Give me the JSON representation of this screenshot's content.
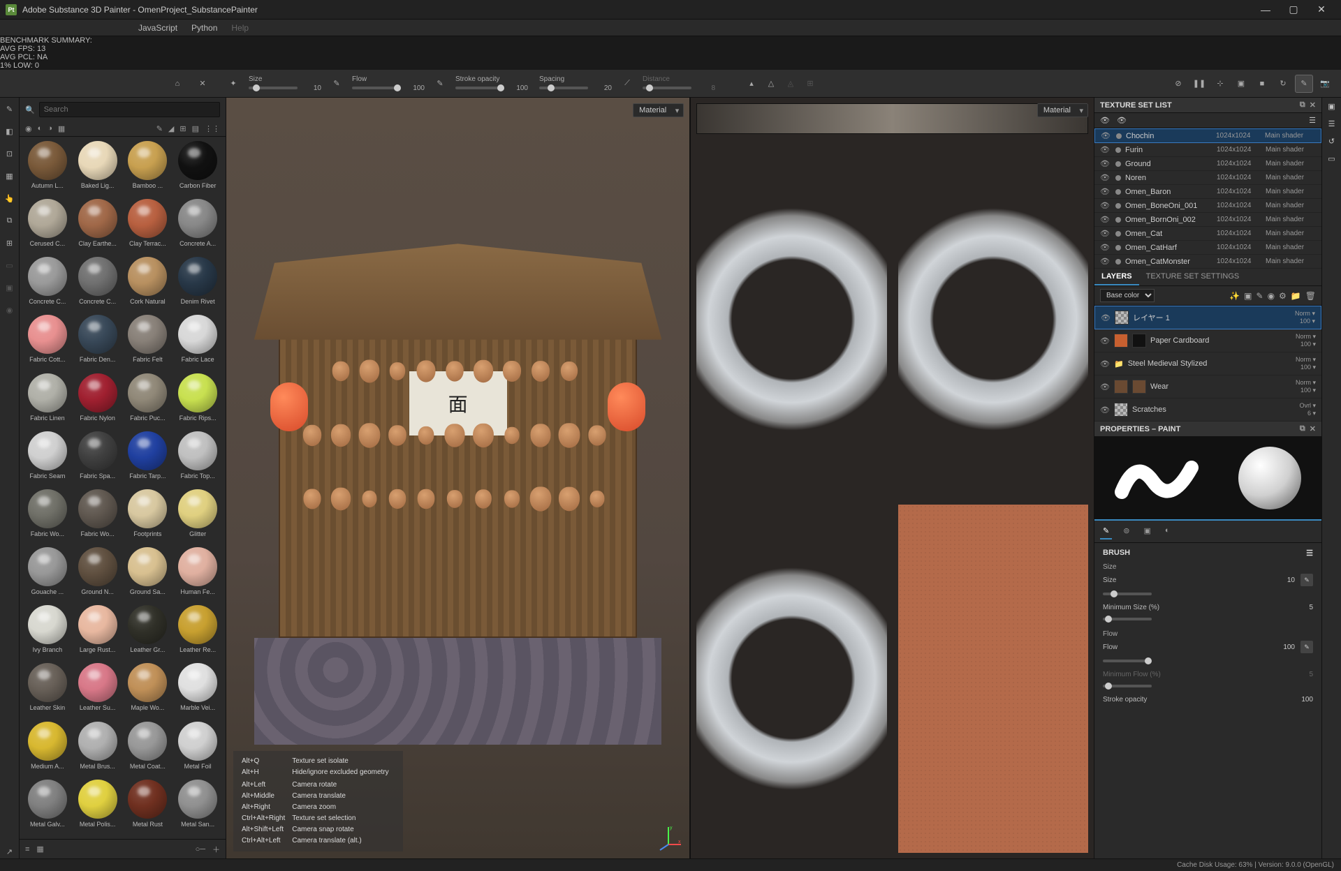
{
  "app": {
    "title": "Adobe Substance 3D Painter - OmenProject_SubstancePainter",
    "icon_label": "Pt"
  },
  "overlay": {
    "l1": "BENCHMARK SUMMARY:",
    "l2": "AVG FPS:    13",
    "l3": "AVG PCL:    NA",
    "l4": "1%  LOW:     0"
  },
  "menu": {
    "javascript": "JavaScript",
    "python": "Python",
    "help": "Help"
  },
  "toolbar": {
    "size_label": "Size",
    "size_val": "10",
    "flow_label": "Flow",
    "flow_val": "100",
    "opacity_label": "Stroke opacity",
    "opacity_val": "100",
    "spacing_label": "Spacing",
    "spacing_val": "20",
    "distance_label": "Distance",
    "distance_val": "8"
  },
  "shelf": {
    "search_placeholder": "Search",
    "materials": [
      {
        "n": "Autumn L...",
        "c": "#7a5a3a"
      },
      {
        "n": "Baked Lig...",
        "c": "#e8d8b8"
      },
      {
        "n": "Bamboo ...",
        "c": "#c8a050"
      },
      {
        "n": "Carbon Fiber",
        "c": "#111111"
      },
      {
        "n": "Cerused C...",
        "c": "#b0a898"
      },
      {
        "n": "Clay Earthe...",
        "c": "#a06848"
      },
      {
        "n": "Clay Terrac...",
        "c": "#b86040"
      },
      {
        "n": "Concrete A...",
        "c": "#888888"
      },
      {
        "n": "Concrete C...",
        "c": "#9a9a9a"
      },
      {
        "n": "Concrete C...",
        "c": "#707070"
      },
      {
        "n": "Cork Natural",
        "c": "#b89060"
      },
      {
        "n": "Denim Rivet",
        "c": "#283848"
      },
      {
        "n": "Fabric Cott...",
        "c": "#e89090"
      },
      {
        "n": "Fabric Den...",
        "c": "#384858"
      },
      {
        "n": "Fabric Felt",
        "c": "#888078"
      },
      {
        "n": "Fabric Lace",
        "c": "#d8d8d8"
      },
      {
        "n": "Fabric Linen",
        "c": "#b0b0a8"
      },
      {
        "n": "Fabric Nylon",
        "c": "#a02030"
      },
      {
        "n": "Fabric Puc...",
        "c": "#908878"
      },
      {
        "n": "Fabric Rips...",
        "c": "#c8e050"
      },
      {
        "n": "Fabric Seam",
        "c": "#d0d0d0"
      },
      {
        "n": "Fabric Spa...",
        "c": "#404040"
      },
      {
        "n": "Fabric Tarp...",
        "c": "#2040a0"
      },
      {
        "n": "Fabric Top...",
        "c": "#c0c0c0"
      },
      {
        "n": "Fabric Wo...",
        "c": "#707068"
      },
      {
        "n": "Fabric Wo...",
        "c": "#605850"
      },
      {
        "n": "Footprints",
        "c": "#d8c8a0"
      },
      {
        "n": "Glitter",
        "c": "#e0d080"
      },
      {
        "n": "Gouache ...",
        "c": "#989898"
      },
      {
        "n": "Ground N...",
        "c": "#605040"
      },
      {
        "n": "Ground Sa...",
        "c": "#d8c090"
      },
      {
        "n": "Human Fe...",
        "c": "#e0b0a0"
      },
      {
        "n": "Ivy Branch",
        "c": "#d8d8d0"
      },
      {
        "n": "Large Rust...",
        "c": "#e8b8a0"
      },
      {
        "n": "Leather Gr...",
        "c": "#303028"
      },
      {
        "n": "Leather Re...",
        "c": "#c8a030"
      },
      {
        "n": "Leather Skin",
        "c": "#686058"
      },
      {
        "n": "Leather Su...",
        "c": "#d87888"
      },
      {
        "n": "Maple Wo...",
        "c": "#c09058"
      },
      {
        "n": "Marble Vei...",
        "c": "#e0e0e0"
      },
      {
        "n": "Medium A...",
        "c": "#d8b830"
      },
      {
        "n": "Metal Brus...",
        "c": "#b0b0b0"
      },
      {
        "n": "Metal Coat...",
        "c": "#989898"
      },
      {
        "n": "Metal Foil",
        "c": "#d0d0d0"
      },
      {
        "n": "Metal Galv...",
        "c": "#808080"
      },
      {
        "n": "Metal Polis...",
        "c": "#e0d040"
      },
      {
        "n": "Metal Rust",
        "c": "#703020"
      },
      {
        "n": "Metal San...",
        "c": "#909090"
      }
    ]
  },
  "viewport": {
    "material_label": "Material",
    "banner_char": "面",
    "hotkeys": [
      [
        "Alt+Q",
        "Texture set isolate"
      ],
      [
        "Alt+H",
        "Hide/ignore excluded geometry"
      ],
      [
        "",
        ""
      ],
      [
        "Alt+Left",
        "Camera rotate"
      ],
      [
        "Alt+Middle",
        "Camera translate"
      ],
      [
        "Alt+Right",
        "Camera zoom"
      ],
      [
        "Ctrl+Alt+Right",
        "Texture set selection"
      ],
      [
        "Alt+Shift+Left",
        "Camera snap rotate"
      ],
      [
        "Ctrl+Alt+Left",
        "Camera translate (alt.)"
      ]
    ]
  },
  "texset": {
    "title": "TEXTURE SET LIST",
    "rows": [
      {
        "n": "Chochin",
        "r": "1024x1024",
        "s": "Main shader",
        "sel": true
      },
      {
        "n": "Furin",
        "r": "1024x1024",
        "s": "Main shader"
      },
      {
        "n": "Ground",
        "r": "1024x1024",
        "s": "Main shader"
      },
      {
        "n": "Noren",
        "r": "1024x1024",
        "s": "Main shader"
      },
      {
        "n": "Omen_Baron",
        "r": "1024x1024",
        "s": "Main shader"
      },
      {
        "n": "Omen_BoneOni_001",
        "r": "1024x1024",
        "s": "Main shader"
      },
      {
        "n": "Omen_BornOni_002",
        "r": "1024x1024",
        "s": "Main shader"
      },
      {
        "n": "Omen_Cat",
        "r": "1024x1024",
        "s": "Main shader"
      },
      {
        "n": "Omen_CatHarf",
        "r": "1024x1024",
        "s": "Main shader"
      },
      {
        "n": "Omen_CatMonster",
        "r": "1024x1024",
        "s": "Main shader"
      }
    ]
  },
  "layers": {
    "tab_layers": "LAYERS",
    "tab_settings": "TEXTURE SET SETTINGS",
    "channel": "Base color",
    "rows": [
      {
        "n": "レイヤー 1",
        "b": "Norm",
        "o": "100",
        "sel": true,
        "t": "checker"
      },
      {
        "n": "Paper Cardboard",
        "b": "Norm",
        "o": "100",
        "t": "orange",
        "m": "black"
      },
      {
        "n": "Steel Medieval Stylized",
        "b": "Norm",
        "o": "100",
        "t": "steel",
        "folder": true
      },
      {
        "n": "Wear",
        "b": "Norm",
        "o": "100",
        "t": "brown",
        "m": "brown"
      },
      {
        "n": "Scratches",
        "b": "Ovrl",
        "o": "6",
        "t": "checker"
      }
    ]
  },
  "props": {
    "title": "PROPERTIES – PAINT",
    "brush_title": "BRUSH",
    "size_section": "Size",
    "size_label": "Size",
    "size_val": "10",
    "minsize_label": "Minimum Size (%)",
    "minsize_val": "5",
    "flow_section": "Flow",
    "flow_label": "Flow",
    "flow_val": "100",
    "minflow_label": "Minimum Flow (%)",
    "minflow_val": "5",
    "opacity_section": "Stroke opacity",
    "opacity_val": "100"
  },
  "status": {
    "text": "Cache Disk Usage:   63% | Version: 9.0.0 (OpenGL)"
  }
}
